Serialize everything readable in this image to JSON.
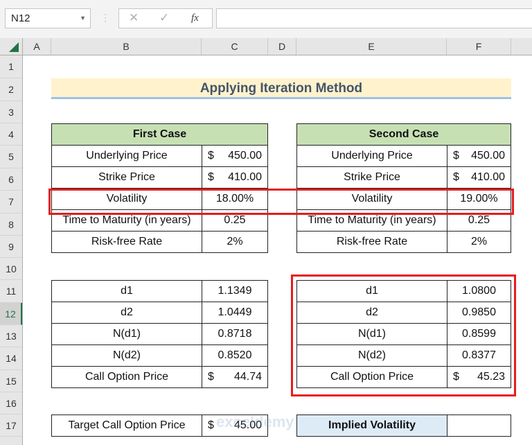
{
  "formula_bar": {
    "name_box": "N12",
    "cancel_icon": "✕",
    "enter_icon": "✓",
    "fx_label": "fx",
    "formula_value": ""
  },
  "columns": [
    "A",
    "B",
    "C",
    "D",
    "E",
    "F"
  ],
  "rows": [
    "1",
    "2",
    "3",
    "4",
    "5",
    "6",
    "7",
    "8",
    "9",
    "10",
    "11",
    "12",
    "13",
    "14",
    "15",
    "16",
    "17"
  ],
  "selected_row": "12",
  "title": "Applying Iteration Method",
  "first_case": {
    "header": "First Case",
    "inputs": [
      {
        "label": "Underlying Price",
        "currency": "$",
        "value": "450.00"
      },
      {
        "label": "Strike Price",
        "currency": "$",
        "value": "410.00"
      },
      {
        "label": "Volatility",
        "currency": "",
        "value": "18.00%"
      },
      {
        "label": "Time to Maturity (in years)",
        "currency": "",
        "value": "0.25"
      },
      {
        "label": "Risk-free Rate",
        "currency": "",
        "value": "2%"
      }
    ],
    "results": [
      {
        "label": "d1",
        "currency": "",
        "value": "1.1349"
      },
      {
        "label": "d2",
        "currency": "",
        "value": "1.0449"
      },
      {
        "label": "N(d1)",
        "currency": "",
        "value": "0.8718"
      },
      {
        "label": "N(d2)",
        "currency": "",
        "value": "0.8520"
      },
      {
        "label": "Call Option Price",
        "currency": "$",
        "value": "44.74"
      }
    ]
  },
  "second_case": {
    "header": "Second Case",
    "inputs": [
      {
        "label": "Underlying Price",
        "currency": "$",
        "value": "450.00"
      },
      {
        "label": "Strike Price",
        "currency": "$",
        "value": "410.00"
      },
      {
        "label": "Volatility",
        "currency": "",
        "value": "19.00%"
      },
      {
        "label": "Time to Maturity (in years)",
        "currency": "",
        "value": "0.25"
      },
      {
        "label": "Risk-free Rate",
        "currency": "",
        "value": "2%"
      }
    ],
    "results": [
      {
        "label": "d1",
        "currency": "",
        "value": "1.0800"
      },
      {
        "label": "d2",
        "currency": "",
        "value": "0.9850"
      },
      {
        "label": "N(d1)",
        "currency": "",
        "value": "0.8599"
      },
      {
        "label": "N(d2)",
        "currency": "",
        "value": "0.8377"
      },
      {
        "label": "Call Option Price",
        "currency": "$",
        "value": "45.23"
      }
    ]
  },
  "target": {
    "label": "Target Call Option Price",
    "currency": "$",
    "value": "45.00"
  },
  "implied": {
    "label": "Implied Volatility",
    "value": ""
  },
  "watermark": "exceldemy",
  "colors": {
    "header_green": "#c6e0b4",
    "title_bg": "#fff2cc",
    "highlight_red": "#e51c1c",
    "implied_bg": "#ddebf7"
  }
}
